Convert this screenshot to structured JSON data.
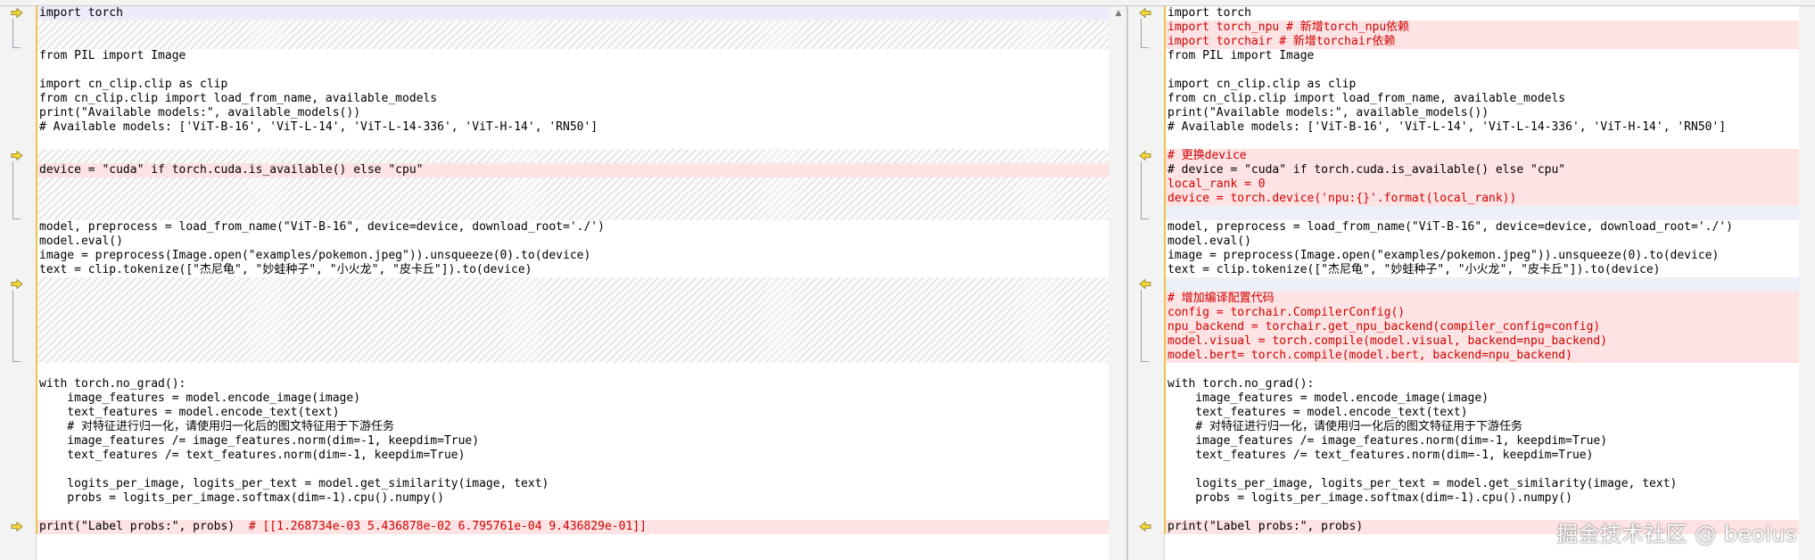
{
  "left": {
    "lines": [
      {
        "kind": "hl",
        "text": "import torch"
      },
      {
        "kind": "hatch",
        "text": ""
      },
      {
        "kind": "hatch",
        "text": ""
      },
      {
        "kind": "ctx",
        "text": "from PIL import Image"
      },
      {
        "kind": "ctx",
        "text": ""
      },
      {
        "kind": "ctx",
        "text": "import cn_clip.clip as clip"
      },
      {
        "kind": "ctx",
        "text": "from cn_clip.clip import load_from_name, available_models"
      },
      {
        "kind": "ctx",
        "text": "print(\"Available models:\", available_models())"
      },
      {
        "kind": "ctx",
        "text": "# Available models: ['ViT-B-16', 'ViT-L-14', 'ViT-L-14-336', 'ViT-H-14', 'RN50']"
      },
      {
        "kind": "ctx",
        "text": ""
      },
      {
        "kind": "hatch",
        "text": ""
      },
      {
        "kind": "changed",
        "text": "device = \"cuda\" if torch.cuda.is_available() else \"cpu\""
      },
      {
        "kind": "hatch",
        "text": ""
      },
      {
        "kind": "hatch",
        "text": ""
      },
      {
        "kind": "hatch",
        "text": ""
      },
      {
        "kind": "ctx",
        "text": "model, preprocess = load_from_name(\"ViT-B-16\", device=device, download_root='./')"
      },
      {
        "kind": "ctx",
        "text": "model.eval()"
      },
      {
        "kind": "ctx",
        "text": "image = preprocess(Image.open(\"examples/pokemon.jpeg\")).unsqueeze(0).to(device)"
      },
      {
        "kind": "ctx",
        "text": "text = clip.tokenize([\"杰尼龟\", \"妙蛙种子\", \"小火龙\", \"皮卡丘\"]).to(device)"
      },
      {
        "kind": "hatch",
        "text": ""
      },
      {
        "kind": "hatch",
        "text": ""
      },
      {
        "kind": "hatch",
        "text": ""
      },
      {
        "kind": "hatch",
        "text": ""
      },
      {
        "kind": "hatch",
        "text": ""
      },
      {
        "kind": "hatch",
        "text": ""
      },
      {
        "kind": "ctx",
        "text": ""
      },
      {
        "kind": "ctx",
        "text": "with torch.no_grad():"
      },
      {
        "kind": "ctx",
        "text": "    image_features = model.encode_image(image)"
      },
      {
        "kind": "ctx",
        "text": "    text_features = model.encode_text(text)"
      },
      {
        "kind": "ctx",
        "text": "    # 对特征进行归一化，请使用归一化后的图文特征用于下游任务"
      },
      {
        "kind": "ctx",
        "text": "    image_features /= image_features.norm(dim=-1, keepdim=True)"
      },
      {
        "kind": "ctx",
        "text": "    text_features /= text_features.norm(dim=-1, keepdim=True)"
      },
      {
        "kind": "ctx",
        "text": ""
      },
      {
        "kind": "ctx",
        "text": "    logits_per_image, logits_per_text = model.get_similarity(image, text)"
      },
      {
        "kind": "ctx",
        "text": "    probs = logits_per_image.softmax(dim=-1).cpu().numpy()"
      },
      {
        "kind": "ctx",
        "text": ""
      },
      {
        "kind": "changed",
        "text": "print(\"Label probs:\", probs)  ",
        "red": "# [[1.268734e-03 5.436878e-02 6.795761e-04 9.436829e-01]]"
      }
    ]
  },
  "right": {
    "lines": [
      {
        "kind": "ctx",
        "text": "import torch"
      },
      {
        "kind": "added",
        "text": "import torch_npu # 新增torch_npu依赖"
      },
      {
        "kind": "added",
        "text": "import torchair # 新增torchair依赖"
      },
      {
        "kind": "ctx",
        "text": "from PIL import Image"
      },
      {
        "kind": "ctx",
        "text": ""
      },
      {
        "kind": "ctx",
        "text": "import cn_clip.clip as clip"
      },
      {
        "kind": "ctx",
        "text": "from cn_clip.clip import load_from_name, available_models"
      },
      {
        "kind": "ctx",
        "text": "print(\"Available models:\", available_models())"
      },
      {
        "kind": "ctx",
        "text": "# Available models: ['ViT-B-16', 'ViT-L-14', 'ViT-L-14-336', 'ViT-H-14', 'RN50']"
      },
      {
        "kind": "ctx",
        "text": ""
      },
      {
        "kind": "added",
        "text": "# 更换device"
      },
      {
        "kind": "changedblack",
        "text": "# device = \"cuda\" if torch.cuda.is_available() else \"cpu\""
      },
      {
        "kind": "added",
        "text": "local_rank = 0"
      },
      {
        "kind": "added",
        "text": "device = torch.device('npu:{}'.format(local_rank))"
      },
      {
        "kind": "sep",
        "text": ""
      },
      {
        "kind": "ctx",
        "text": "model, preprocess = load_from_name(\"ViT-B-16\", device=device, download_root='./')"
      },
      {
        "kind": "ctx",
        "text": "model.eval()"
      },
      {
        "kind": "ctx",
        "text": "image = preprocess(Image.open(\"examples/pokemon.jpeg\")).unsqueeze(0).to(device)"
      },
      {
        "kind": "ctx",
        "text": "text = clip.tokenize([\"杰尼龟\", \"妙蛙种子\", \"小火龙\", \"皮卡丘\"]).to(device)"
      },
      {
        "kind": "sep",
        "text": ""
      },
      {
        "kind": "added",
        "text": "# 增加编译配置代码"
      },
      {
        "kind": "added",
        "text": "config = torchair.CompilerConfig()"
      },
      {
        "kind": "added",
        "text": "npu_backend = torchair.get_npu_backend(compiler_config=config)"
      },
      {
        "kind": "added",
        "text": "model.visual = torch.compile(model.visual, backend=npu_backend)"
      },
      {
        "kind": "added",
        "text": "model.bert= torch.compile(model.bert, backend=npu_backend)"
      },
      {
        "kind": "ctx",
        "text": ""
      },
      {
        "kind": "ctx",
        "text": "with torch.no_grad():"
      },
      {
        "kind": "ctx",
        "text": "    image_features = model.encode_image(image)"
      },
      {
        "kind": "ctx",
        "text": "    text_features = model.encode_text(text)"
      },
      {
        "kind": "ctx",
        "text": "    # 对特征进行归一化，请使用归一化后的图文特征用于下游任务"
      },
      {
        "kind": "ctx",
        "text": "    image_features /= image_features.norm(dim=-1, keepdim=True)"
      },
      {
        "kind": "ctx",
        "text": "    text_features /= text_features.norm(dim=-1, keepdim=True)"
      },
      {
        "kind": "ctx",
        "text": ""
      },
      {
        "kind": "ctx",
        "text": "    logits_per_image, logits_per_text = model.get_similarity(image, text)"
      },
      {
        "kind": "ctx",
        "text": "    probs = logits_per_image.softmax(dim=-1).cpu().numpy()"
      },
      {
        "kind": "ctx",
        "text": ""
      },
      {
        "kind": "changedblack",
        "text": "print(\"Label probs:\", probs)"
      }
    ]
  },
  "diff_blocks": [
    {
      "start": 0,
      "end": 2
    },
    {
      "start": 10,
      "end": 14
    },
    {
      "start": 19,
      "end": 24
    },
    {
      "start": 36,
      "end": 36
    }
  ],
  "icons": {
    "left_arrow": "arrow-right-icon",
    "right_arrow": "arrow-left-icon",
    "scroll": "scroll-up-icon"
  },
  "colors": {
    "changed_bg": "#fde3e3",
    "added_text": "#d10000",
    "arrow_fill": "#f2d73a"
  },
  "watermark": "掘金技术社区 @ beolus"
}
